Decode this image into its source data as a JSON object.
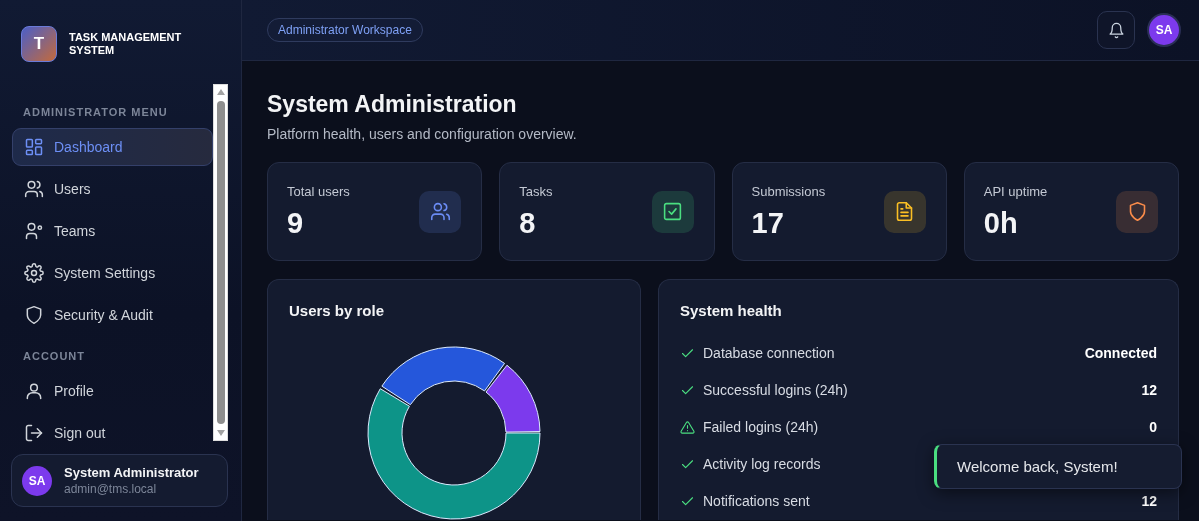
{
  "brand": {
    "logo_letter": "T",
    "name": "TASK MANAGEMENT SYSTEM"
  },
  "sidebar": {
    "sections": [
      {
        "heading": "ADMINISTRATOR MENU",
        "items": [
          {
            "label": "Dashboard",
            "selected": true
          },
          {
            "label": "Users",
            "selected": false
          },
          {
            "label": "Teams",
            "selected": false
          },
          {
            "label": "System Settings",
            "selected": false
          },
          {
            "label": "Security & Audit",
            "selected": false
          }
        ]
      },
      {
        "heading": "ACCOUNT",
        "items": [
          {
            "label": "Profile",
            "selected": false
          },
          {
            "label": "Sign out",
            "selected": false
          }
        ]
      }
    ]
  },
  "user_card": {
    "initials": "SA",
    "name": "System Administrator",
    "email": "admin@tms.local"
  },
  "topbar": {
    "badge": "Administrator Workspace",
    "avatar_initials": "SA"
  },
  "page": {
    "title": "System Administration",
    "subtitle": "Platform health, users and configuration overview."
  },
  "stats": [
    {
      "label": "Total users",
      "value": "9",
      "color": "#6b8cf5"
    },
    {
      "label": "Tasks",
      "value": "8",
      "color": "#4ade80"
    },
    {
      "label": "Submissions",
      "value": "17",
      "color": "#fbbf24"
    },
    {
      "label": "API uptime",
      "value": "0h",
      "color": "#fb8c4a"
    }
  ],
  "users_by_role": {
    "title": "Users by role"
  },
  "system_health": {
    "title": "System health",
    "rows": [
      {
        "label": "Database connection",
        "value": "Connected",
        "kind": "check"
      },
      {
        "label": "Successful logins (24h)",
        "value": "12",
        "kind": "check"
      },
      {
        "label": "Failed logins (24h)",
        "value": "0",
        "kind": "warning"
      },
      {
        "label": "Activity log records",
        "kind": "check"
      },
      {
        "label": "Notifications sent",
        "value": "12",
        "kind": "check"
      }
    ]
  },
  "toast": {
    "message": "Welcome back, System!"
  }
}
